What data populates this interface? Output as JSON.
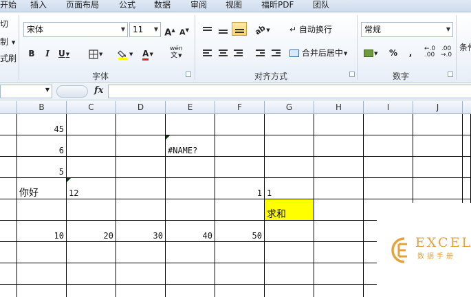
{
  "tabs": [
    "开始",
    "插入",
    "页面布局",
    "公式",
    "数据",
    "审阅",
    "视图",
    "福昕PDF",
    "团队"
  ],
  "clipboard": {
    "cut": "切",
    "paste_format": "制",
    "format_painter": "式刷"
  },
  "font_group": {
    "font_name": "宋体",
    "font_size": "11",
    "grow": "A",
    "shrink": "A",
    "bold": "B",
    "italic": "I",
    "underline": "U",
    "phonetic": "wén",
    "label": "字体"
  },
  "align_group": {
    "wrap_text": "自动换行",
    "merge_center": "合并后居中",
    "label": "对齐方式"
  },
  "number_group": {
    "format": "常规",
    "percent": "%",
    "comma": ",",
    "label": "数字"
  },
  "styles_group": {
    "conditional": "条件"
  },
  "formula_bar": {
    "name_box": "",
    "fx": "fx",
    "formula": ""
  },
  "columns": [
    "B",
    "C",
    "D",
    "E",
    "F",
    "G",
    "H",
    "I",
    "J"
  ],
  "cells": {
    "r0": {
      "B": "45"
    },
    "r1": {
      "B": "6",
      "E": "#NAME?"
    },
    "r2": {
      "B": "5"
    },
    "r3": {
      "B": "你好",
      "C": "12",
      "F": "1",
      "G": "1"
    },
    "r4": {
      "G": "求和"
    },
    "r5": {
      "B": "10",
      "C": "20",
      "D": "30",
      "E": "40",
      "F": "50"
    }
  },
  "colors": {
    "highlight": "#ffff00",
    "error_triangle": "#0a3d0a",
    "logo": "#e5a23b"
  },
  "logo": {
    "title": "EXCEL",
    "subtitle": "数据手册"
  }
}
